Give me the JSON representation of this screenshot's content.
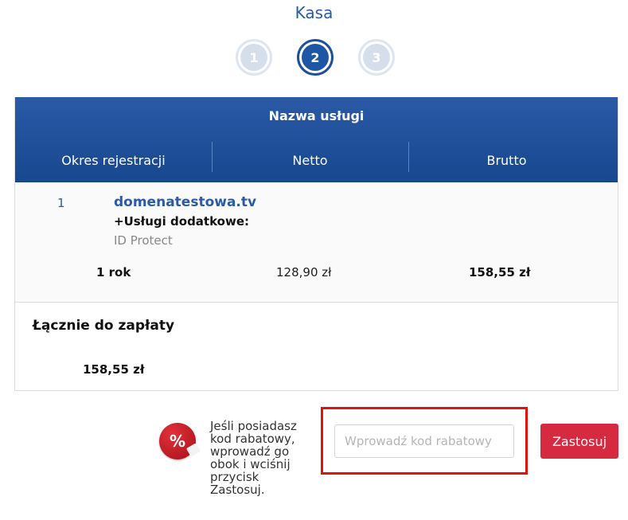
{
  "page": {
    "title": "Kasa"
  },
  "steps": [
    {
      "label": "1",
      "state": "inactive"
    },
    {
      "label": "2",
      "state": "active"
    },
    {
      "label": "3",
      "state": "inactive"
    }
  ],
  "table": {
    "header": {
      "service": "Nazwa usługi",
      "period": "Okres rejestracji",
      "netto": "Netto",
      "brutto": "Brutto"
    },
    "items": [
      {
        "index": "1",
        "domain": "domenatestowa.tv",
        "extras_label": "+Usługi dodatkowe:",
        "extras": [
          "ID Protect"
        ],
        "period": "1 rok",
        "netto": "128,90 zł",
        "brutto": "158,55 zł"
      }
    ],
    "total_label": "Łącznie do zapłaty",
    "total_value": "158,55 zł"
  },
  "coupon": {
    "info_text": "Jeśli posiadasz kod rabatowy, wprowadź go obok i wciśnij przycisk Zastosuj.",
    "placeholder": "Wprowadź kod rabatowy",
    "button_label": "Zastosuj",
    "icon": "percent-badge-icon"
  },
  "colors": {
    "primary": "#1e56a6",
    "accent_button": "#d62a40",
    "highlight": "#e0140a"
  }
}
